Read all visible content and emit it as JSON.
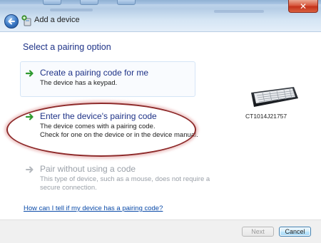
{
  "window": {
    "title": "Add a device",
    "close_glyph": "✕"
  },
  "icons": {
    "back": "back-arrow-icon",
    "device": "add-device-icon",
    "arrow": "green-arrow-icon",
    "arrow_disabled": "grey-arrow-icon",
    "keyboard": "keyboard-icon"
  },
  "main": {
    "heading": "Select a pairing option",
    "options": [
      {
        "title": "Create a pairing code for me",
        "desc": [
          "The device has a keypad."
        ],
        "enabled": true
      },
      {
        "title": "Enter the device's pairing code",
        "desc": [
          "The device comes with a pairing code.",
          "Check for one on the device or in the device manual."
        ],
        "enabled": true
      },
      {
        "title": "Pair without using a code",
        "desc": [
          "This type of device, such as a mouse, does not require a",
          "secure connection."
        ],
        "enabled": false
      }
    ],
    "device_name": "CT1014J21757",
    "help_link": "How can I tell if my device has a pairing code?"
  },
  "footer": {
    "next_label": "Next",
    "cancel_label": "Cancel"
  },
  "colors": {
    "accent_text": "#1e3287",
    "link": "#0a4aa8",
    "arrow_green": "#2f9a2f",
    "highlight": "#8e2a2a"
  }
}
